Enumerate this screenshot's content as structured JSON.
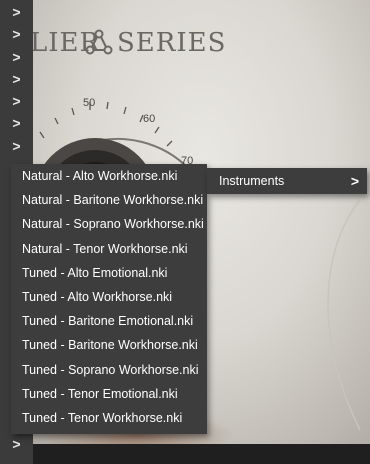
{
  "logo": {
    "text_left": "LIER",
    "text_right": "SERIES",
    "mark_icon": "triangle-nodes-icon"
  },
  "knob": {
    "labels": [
      "50",
      "60",
      "70"
    ]
  },
  "rail": {
    "chevron_icon": "chevron-right-icon",
    "glyph": ">"
  },
  "menu": {
    "items": [
      "Natural - Alto Workhorse.nki",
      "Natural - Baritone Workhorse.nki",
      "Natural - Soprano Workhorse.nki",
      "Natural - Tenor Workhorse.nki",
      "Tuned - Alto Emotional.nki",
      "Tuned - Alto Workhorse.nki",
      "Tuned - Baritone Emotional.nki",
      "Tuned - Baritone Workhorse.nki",
      "Tuned - Soprano Workhorse.nki",
      "Tuned - Tenor Emotional.nki",
      "Tuned - Tenor Workhorse.nki"
    ]
  },
  "submenu": {
    "label": "Instruments",
    "chevron": ">"
  }
}
